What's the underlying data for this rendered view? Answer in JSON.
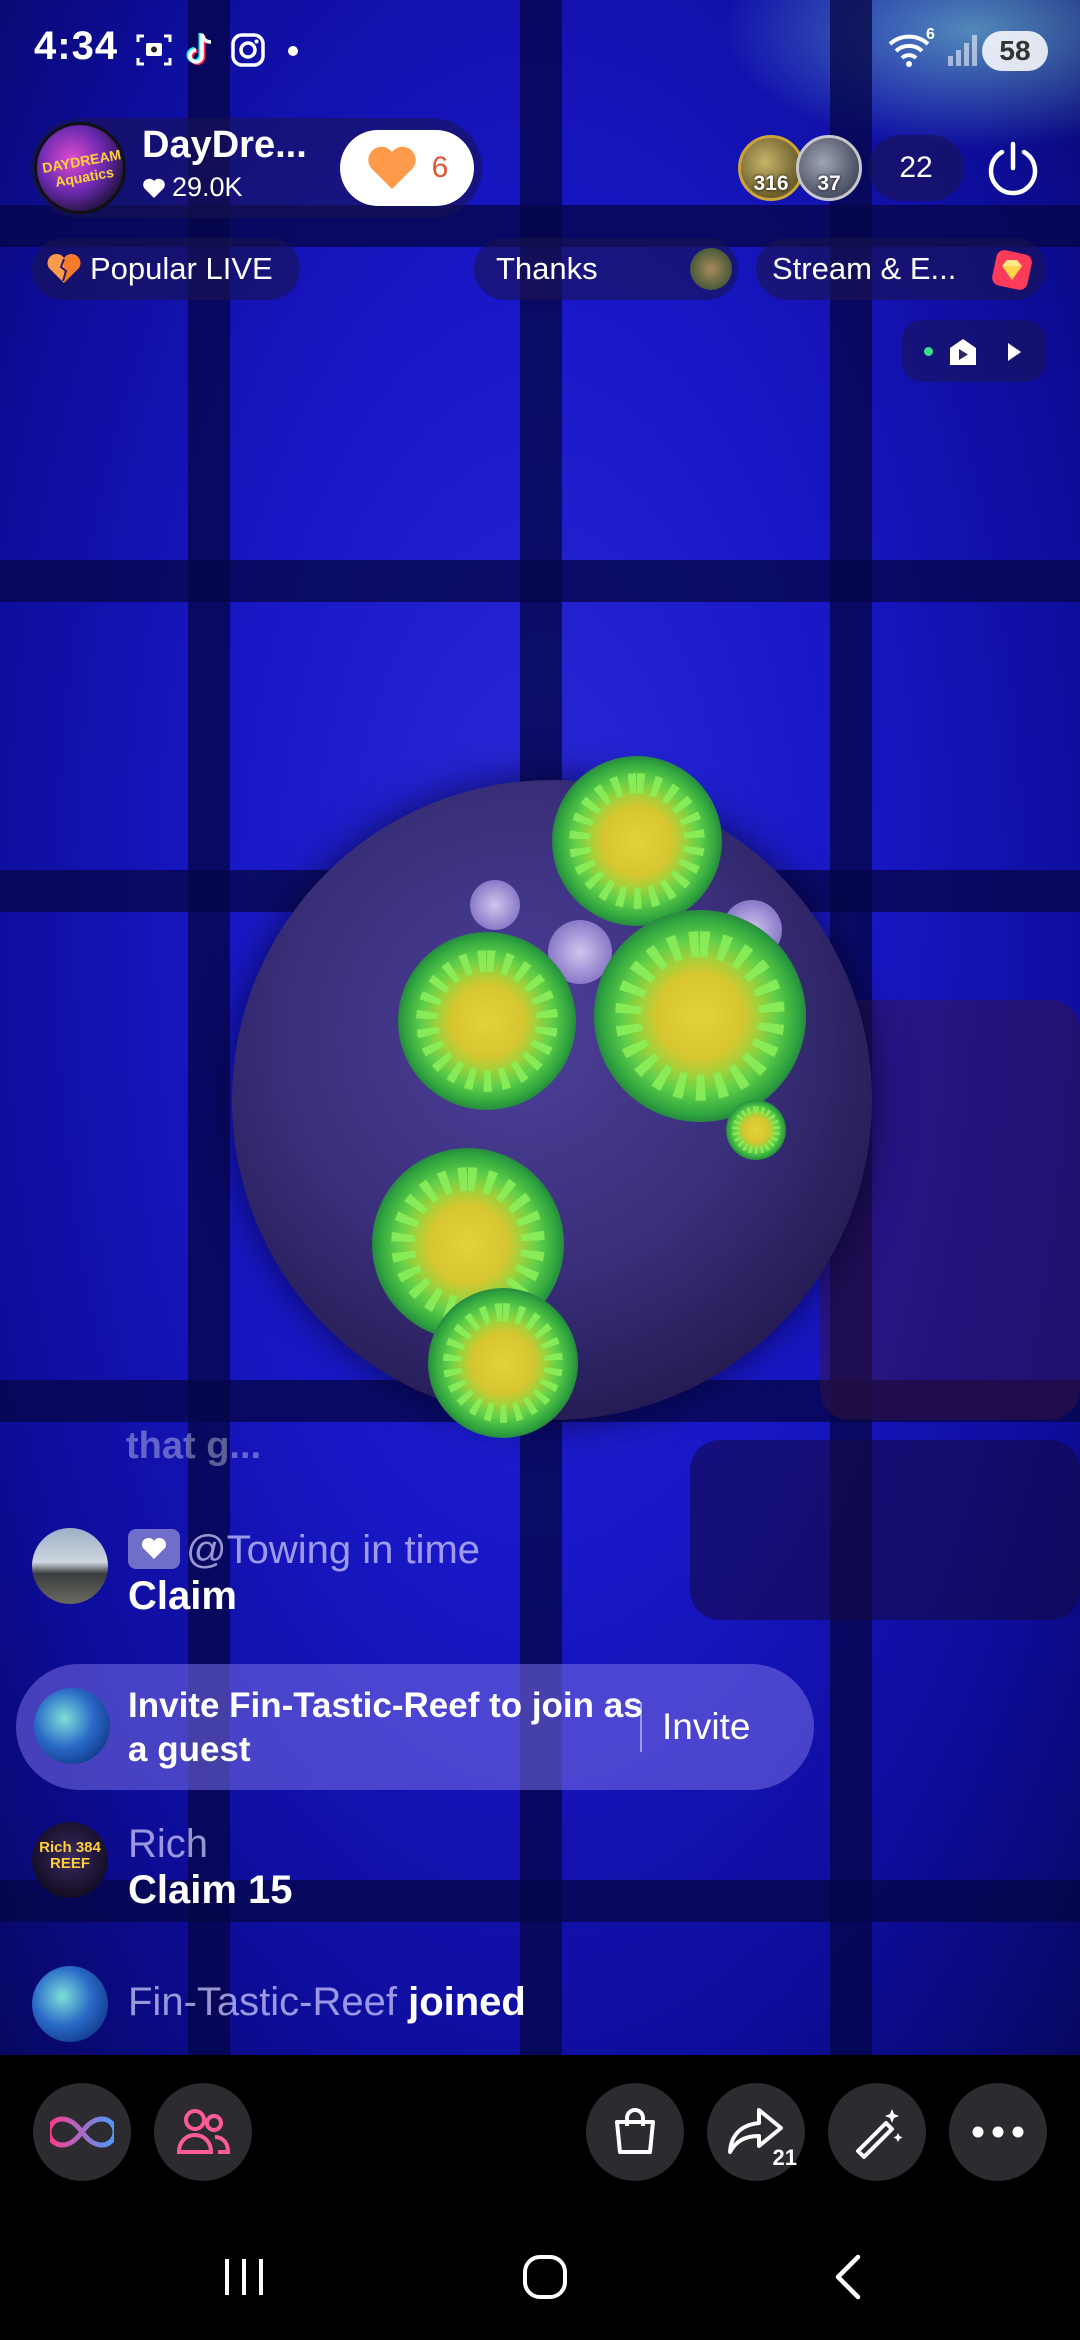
{
  "status_bar": {
    "time": "4:34",
    "battery": "58",
    "network_badge": "6",
    "icons": [
      "screenshot-icon",
      "tiktok-icon",
      "instagram-icon",
      "wifi-icon",
      "signal-icon"
    ]
  },
  "host": {
    "name": "DayDre...",
    "likes": "29.0K",
    "follow_count": "6",
    "avatar_text": "DAYDREAM Aquatics"
  },
  "viewers": {
    "top": [
      {
        "badge": "316"
      },
      {
        "badge": "37"
      }
    ],
    "count": "22"
  },
  "pills": {
    "popular": "Popular LIVE",
    "thanks": "Thanks",
    "stream": "Stream & E..."
  },
  "chat": {
    "faded_text": "that g...",
    "messages": [
      {
        "name": "@Towing in time",
        "text": "Claim"
      },
      {
        "name": "Rich",
        "text": "Claim 15",
        "avatar_text": "Rich 384 REEF"
      }
    ],
    "invite": {
      "text": "Invite Fin-Tastic-Reef to join as a guest",
      "button": "Invite"
    },
    "joined": {
      "name": "Fin-Tastic-Reef",
      "verb": "joined"
    }
  },
  "actions": {
    "share_count": "21"
  },
  "colors": {
    "accent_orange": "#ff9a4a",
    "follow_count": "#e0563b",
    "video_blue": "#1818c8"
  }
}
